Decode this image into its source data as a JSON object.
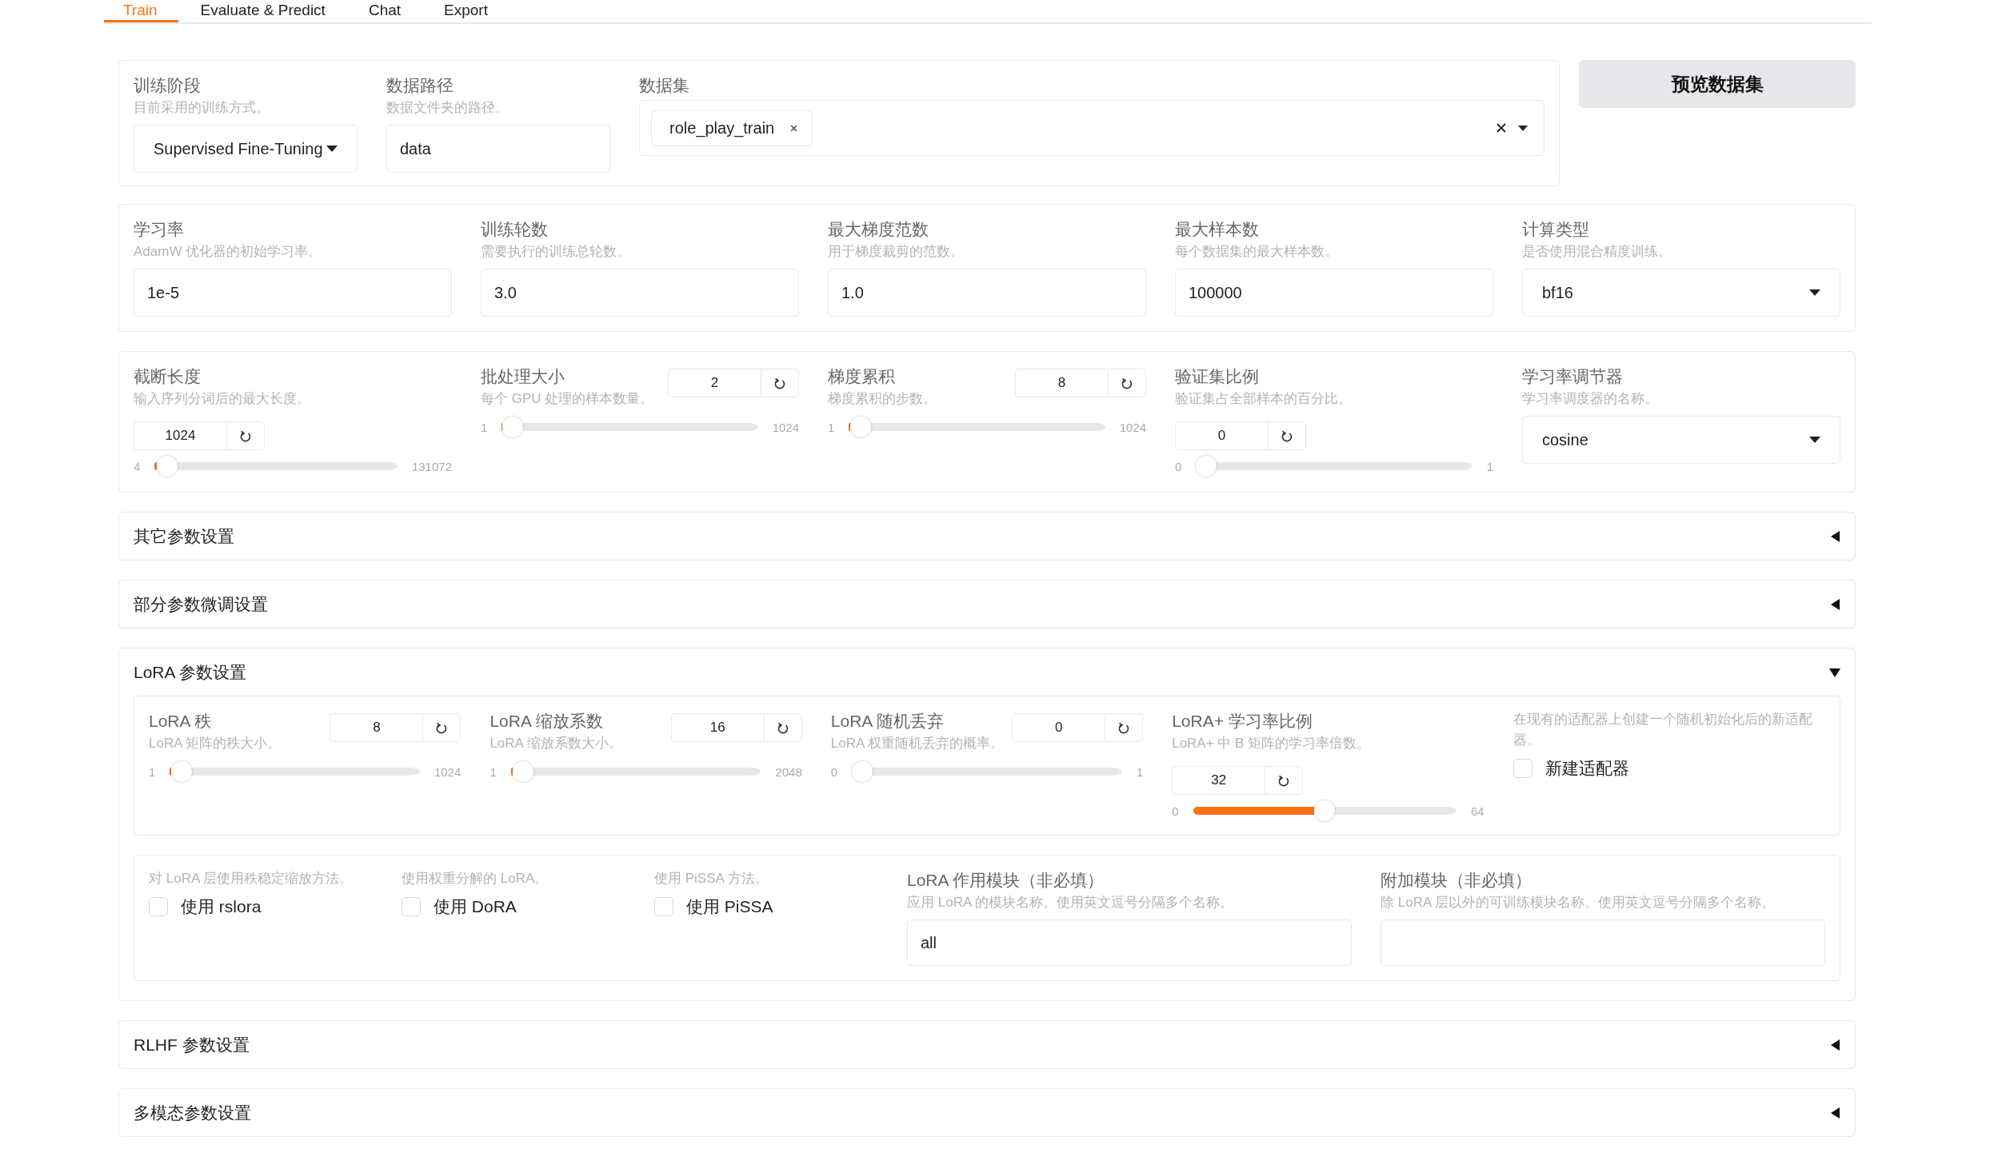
{
  "tabs": [
    {
      "label": "Train",
      "selected": true
    },
    {
      "label": "Evaluate & Predict",
      "selected": false
    },
    {
      "label": "Chat",
      "selected": false
    },
    {
      "label": "Export",
      "selected": false
    }
  ],
  "dataset_row": {
    "fields": [
      {
        "kind": "dropdown",
        "label": "训练阶段",
        "hint": "目前采用的训练方式。",
        "value": "Supervised Fine-Tuning"
      },
      {
        "kind": "text",
        "label": "数据路径",
        "hint": "数据文件夹的路径。",
        "value": "data"
      }
    ],
    "dataset": {
      "label": "数据集",
      "chips": [
        "role_play_train"
      ]
    },
    "preview_button": "预览数据集"
  },
  "basic_params": [
    {
      "kind": "text",
      "label": "学习率",
      "hint": "AdamW 优化器的初始学习率。",
      "value": "1e-5"
    },
    {
      "kind": "text",
      "label": "训练轮数",
      "hint": "需要执行的训练总轮数。",
      "value": "3.0"
    },
    {
      "kind": "text",
      "label": "最大梯度范数",
      "hint": "用于梯度裁剪的范数。",
      "value": "1.0"
    },
    {
      "kind": "text",
      "label": "最大样本数",
      "hint": "每个数据集的最大样本数。",
      "value": "100000"
    },
    {
      "kind": "dropdown",
      "label": "计算类型",
      "hint": "是否使用混合精度训练。",
      "value": "bf16"
    }
  ],
  "slider_params": [
    {
      "kind": "slider",
      "label": "截断长度",
      "hint": "输入序列分词后的最大长度。",
      "value": "1024",
      "min": "4",
      "max": "131072",
      "level": 0.008
    },
    {
      "kind": "slider",
      "label": "批处理大小",
      "hint": "每个 GPU 处理的样本数量。",
      "value": "2",
      "min": "1",
      "max": "1024",
      "level": 0.001
    },
    {
      "kind": "slider",
      "label": "梯度累积",
      "hint": "梯度累积的步数。",
      "value": "8",
      "min": "1",
      "max": "1024",
      "level": 0.007
    },
    {
      "kind": "slider",
      "label": "验证集比例",
      "hint": "验证集占全部样本的百分比。",
      "value": "0",
      "min": "0",
      "max": "1",
      "level": 0
    },
    {
      "kind": "dropdown",
      "label": "学习率调节器",
      "hint": "学习率调度器的名称。",
      "value": "cosine"
    }
  ],
  "accordions": [
    {
      "title": "其它参数设置",
      "expanded": false
    },
    {
      "title": "部分参数微调设置",
      "expanded": false
    },
    {
      "title": "LoRA 参数设置",
      "expanded": true,
      "sliders": [
        {
          "kind": "slider",
          "label": "LoRA 秩",
          "hint": "LoRA 矩阵的秩大小。",
          "value": "8",
          "min": "1",
          "max": "1024",
          "level": 0.007
        },
        {
          "kind": "slider",
          "label": "LoRA 缩放系数",
          "hint": "LoRA 缩放系数大小。",
          "value": "16",
          "min": "1",
          "max": "2048",
          "level": 0.007
        },
        {
          "kind": "slider",
          "label": "LoRA 随机丢弃",
          "hint": "LoRA 权重随机丢弃的概率。",
          "value": "0",
          "min": "0",
          "max": "1",
          "level": 0
        },
        {
          "kind": "slider",
          "label": "LoRA+ 学习率比例",
          "hint": "LoRA+ 中 B 矩阵的学习率倍数。",
          "value": "32",
          "min": "0",
          "max": "64",
          "level": 0.5
        },
        {
          "kind": "checkbox",
          "hint": "在现有的适配器上创建一个随机初始化后的新适配器。",
          "label": "新建适配器",
          "checked": false
        }
      ],
      "options": [
        {
          "kind": "checkbox",
          "hint": "对 LoRA 层使用秩稳定缩放方法。",
          "label": "使用 rslora",
          "checked": false
        },
        {
          "kind": "checkbox",
          "hint": "使用权重分解的 LoRA。",
          "label": "使用 DoRA",
          "checked": false
        },
        {
          "kind": "checkbox",
          "hint": "使用 PiSSA 方法。",
          "label": "使用 PiSSA",
          "checked": false
        },
        {
          "kind": "text",
          "label": "LoRA 作用模块（非必填）",
          "hint": "应用 LoRA 的模块名称。使用英文逗号分隔多个名称。",
          "value": "all"
        },
        {
          "kind": "text",
          "label": "附加模块（非必填）",
          "hint": "除 LoRA 层以外的可训练模块名称。使用英文逗号分隔多个名称。"
        }
      ]
    },
    {
      "title": "RLHF 参数设置",
      "expanded": false
    },
    {
      "title": "多模态参数设置",
      "expanded": false
    }
  ]
}
